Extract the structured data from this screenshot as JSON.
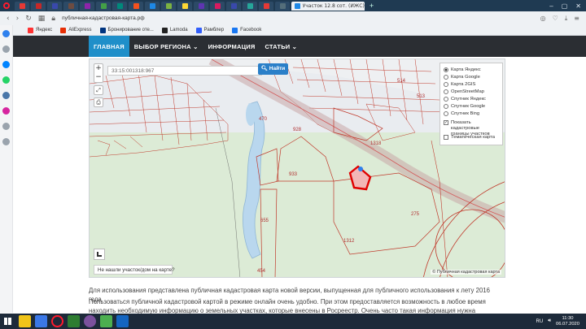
{
  "browser": {
    "active_tab_title": "Участок 12.8 сот. (ИЖС) с",
    "address": "публичная-кадастровая-карта.рф",
    "tab_icons": [
      "#e53935",
      "#c62828",
      "#3949ab",
      "#6d4c41",
      "#8e24aa",
      "#43a047",
      "#00897b",
      "#f4511e",
      "#1e88e5",
      "#7cb342",
      "#fdd835",
      "#5e35b1",
      "#d81b60",
      "#3949ab",
      "#26a69a",
      "#e53935",
      "#546e7a"
    ]
  },
  "bookmarks": [
    {
      "label": "Яндекс",
      "color": "#ff3333"
    },
    {
      "label": "AliExpress",
      "color": "#e62e04"
    },
    {
      "label": "Бронирование оте...",
      "color": "#003580"
    },
    {
      "label": "Lamoda",
      "color": "#222222"
    },
    {
      "label": "Рамблер",
      "color": "#315efb"
    },
    {
      "label": "Facebook",
      "color": "#1877f2"
    }
  ],
  "site_nav": {
    "home": "ГЛАВНАЯ",
    "region": "ВЫБОР РЕГИОНА ⌄",
    "info": "ИНФОРМАЦИЯ",
    "articles": "СТАТЬИ ⌄"
  },
  "map": {
    "cadastral_number": "33:15:001318:967",
    "find_button": "Найти",
    "zoom_in": "+",
    "zoom_out": "−",
    "layers": {
      "yandex": "Карта Яндекс",
      "google": "Карта Google",
      "gis2": "Карта 2GIS",
      "osm": "OpenStreetMap",
      "sat_yandex": "Спутник Яндекс",
      "sat_google": "Спутник Google",
      "sat_bing": "Спутник Bing",
      "show_bounds": "Показать кадастровые границы участков",
      "thematic": "Тематическая карта"
    },
    "not_found": "Не нашли участок/дом на карте?",
    "copyright": "© Публичная кадастровая карта",
    "labels": {
      "l1318": "1318",
      "l1312": "1312",
      "l933": "933",
      "l928": "928",
      "l275": "275",
      "l513": "513",
      "l514": "514",
      "l655": "655",
      "l454": "454",
      "l470": "470"
    },
    "colors": {
      "parcel": "#c0392b",
      "highlight": "#e00000",
      "water": "#b9d7ee",
      "forest": "#d9ecd2"
    }
  },
  "content": {
    "para1": "Для использования представлена публичная кадастровая карта новой версии, выпущенная для публичного использования к лету 2016 года.",
    "para2": "Пользоваться публичной кадастровой картой в режиме онлайн очень удобно. При этом предоставляется возможность в любое время находить необходимую информацию о земельных участках, которые внесены в Росреестр. Очень часто такая информация нужна риелторам, юристам"
  },
  "taskbar": {
    "lang": "RU",
    "time": "11:30",
    "date": "06.07.2020"
  }
}
